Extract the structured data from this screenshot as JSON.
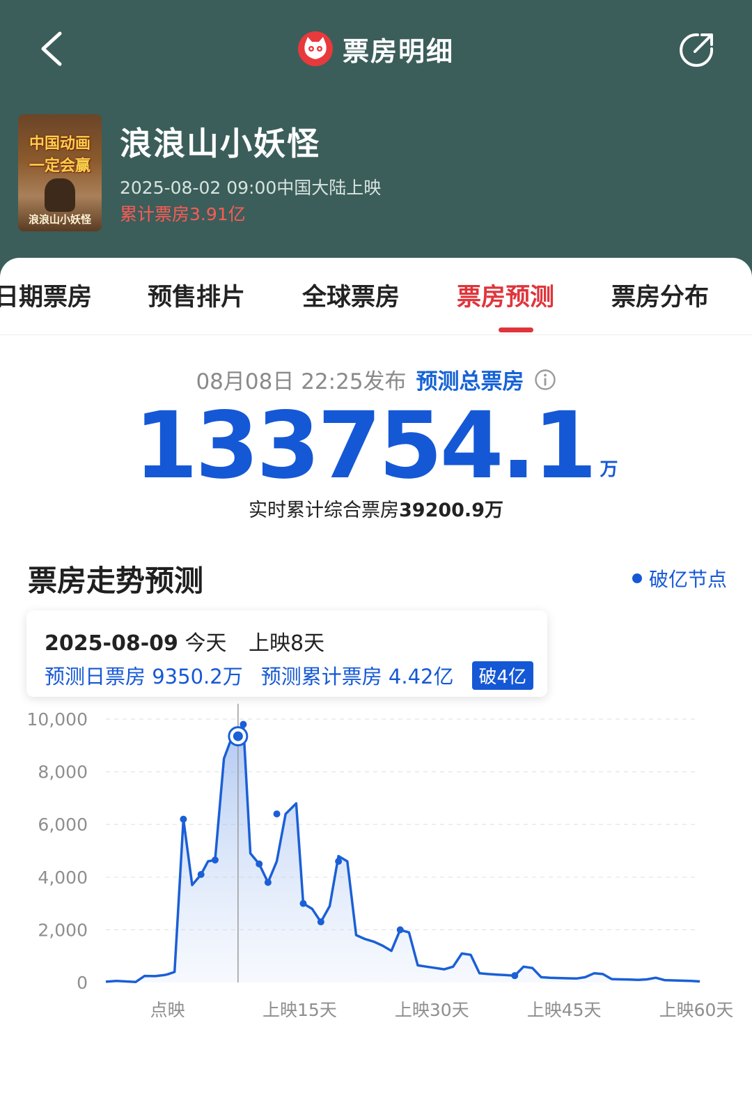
{
  "header": {
    "title": "票房明细",
    "back_icon": "chevron-left-icon",
    "share_icon": "share-icon",
    "logo_icon": "cat-logo-icon",
    "background_color": "#3b5e5a"
  },
  "movie": {
    "poster_text_line1": "中国动画",
    "poster_text_line2": "一定会赢",
    "poster_text_line3": "浪浪山小妖怪",
    "title": "浪浪山小妖怪",
    "release_info": "2025-08-02 09:00中国大陆上映",
    "cumulative_box_office": "累计票房3.91亿"
  },
  "tabs": [
    {
      "label": "日期票房",
      "active": false
    },
    {
      "label": "预售排片",
      "active": false
    },
    {
      "label": "全球票房",
      "active": false
    },
    {
      "label": "票房预测",
      "active": true
    },
    {
      "label": "票房分布",
      "active": false
    }
  ],
  "forecast": {
    "published_time": "08月08日 22:25发布",
    "label": "预测总票房",
    "info_icon": "info-icon",
    "total_value": "133754.1",
    "total_unit": "万",
    "realtime_prefix": "实时累计综合票房",
    "realtime_value": "39200.9万"
  },
  "trend": {
    "section_title": "票房走势预测",
    "legend_label": "破亿节点",
    "tooltip": {
      "date": "2025-08-09",
      "day_label": "今天",
      "days_since": "上映8天",
      "daily_forecast": "预测日票房 9350.2万",
      "cumulative_forecast": "预测累计票房 4.42亿",
      "badge": "破4亿"
    }
  },
  "colors": {
    "accent_red": "#e0343b",
    "accent_blue": "#1558d6",
    "cumulative_red": "#ff5a55"
  },
  "chart_data": {
    "type": "area",
    "ylim": [
      0,
      10000
    ],
    "yticks": [
      0,
      2000,
      4000,
      6000,
      8000,
      10000
    ],
    "ytick_labels": [
      "0",
      "2,000",
      "4,000",
      "6,000",
      "8,000",
      "10,000"
    ],
    "xlim": [
      -7,
      60
    ],
    "xticks": [
      0,
      15,
      30,
      45,
      60
    ],
    "xtick_labels": [
      "点映",
      "上映15天",
      "上映30天",
      "上映45天",
      "上映60天"
    ],
    "grid": true,
    "cursor_x": 8,
    "series": [
      {
        "x": [
          -7,
          -5.8,
          -3.6,
          -2.6,
          -1.4,
          -0.4,
          0,
          0.8,
          1.8,
          2.8,
          3.8,
          4.6,
          5.4,
          6.4,
          7.4,
          8,
          8.6,
          9.4,
          10.4,
          11.4,
          12.4,
          13.4,
          14.6,
          15.4,
          16.4,
          17.4,
          18.4,
          19.4,
          20.4,
          21.4,
          22.4,
          23.4,
          24.4,
          25.4,
          26.4,
          27.4,
          28.4,
          29.4,
          30.4,
          31.4,
          32.4,
          33.4,
          34.4,
          35.4,
          36.4,
          37.4,
          38.4,
          39.4,
          40.4,
          41.4,
          42.4,
          43.4,
          44.4,
          45.4,
          46.4,
          47.4,
          48.4,
          49.4,
          50.4,
          51.4,
          52.4,
          53.4,
          54.4,
          55.4,
          56.4,
          57.4,
          58.4,
          59.4,
          60.4
        ],
        "y": [
          30,
          60,
          20,
          250,
          240,
          280,
          310,
          400,
          6200,
          3700,
          4100,
          4600,
          4650,
          8500,
          9400,
          9350,
          9800,
          4900,
          4500,
          3800,
          4600,
          6400,
          6800,
          3000,
          2800,
          2300,
          2900,
          4800,
          4600,
          1800,
          1650,
          1550,
          1400,
          1200,
          2000,
          1900,
          650,
          600,
          550,
          500,
          600,
          1100,
          1050,
          350,
          320,
          300,
          280,
          260,
          600,
          550,
          200,
          180,
          170,
          160,
          150,
          200,
          350,
          320,
          130,
          120,
          110,
          100,
          120,
          180,
          90,
          80,
          70,
          60,
          40
        ],
        "markers": [
          {
            "x": 1.8,
            "y": 6200
          },
          {
            "x": 3.8,
            "y": 4100
          },
          {
            "x": 5.4,
            "y": 4650
          },
          {
            "x": 8.6,
            "y": 9800
          },
          {
            "x": 10.4,
            "y": 4500
          },
          {
            "x": 11.4,
            "y": 3800
          },
          {
            "x": 12.4,
            "y": 6400
          },
          {
            "x": 15.4,
            "y": 3000
          },
          {
            "x": 17.4,
            "y": 2300
          },
          {
            "x": 19.4,
            "y": 4600
          },
          {
            "x": 26.4,
            "y": 2000
          },
          {
            "x": 39.4,
            "y": 260
          }
        ],
        "highlight": {
          "x": 8,
          "y": 9350
        }
      }
    ]
  }
}
